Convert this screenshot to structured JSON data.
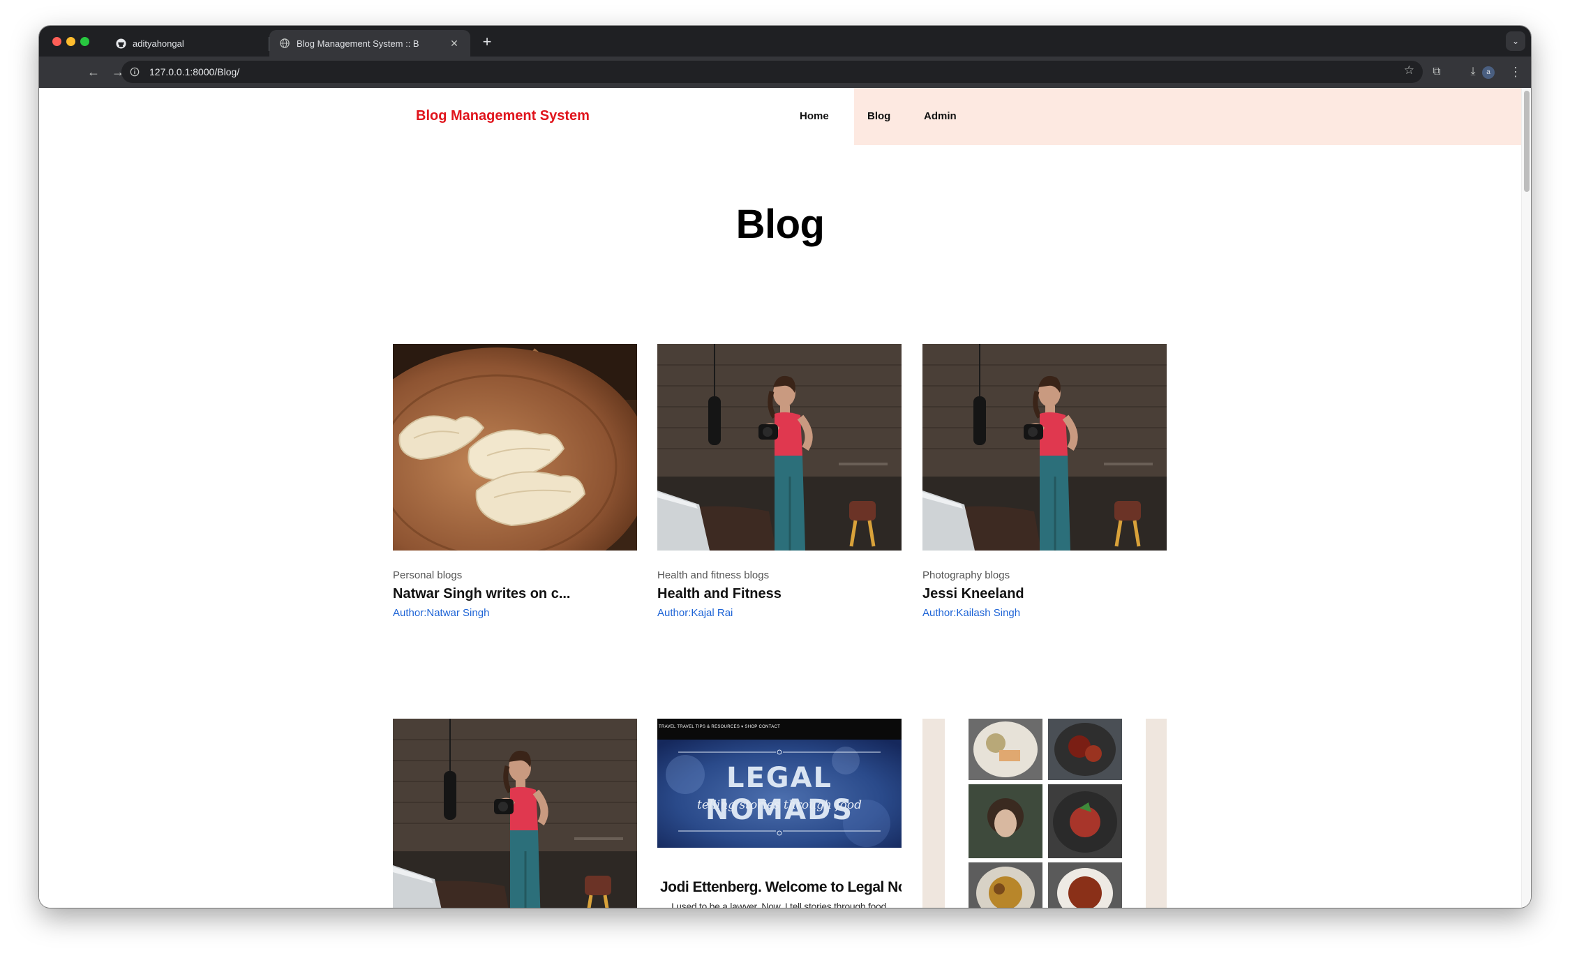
{
  "browser": {
    "tabs": [
      {
        "label": "adityahongal",
        "favicon": "github-icon"
      },
      {
        "label": "Blog Management System :: B",
        "favicon": "globe-icon"
      }
    ],
    "url": "127.0.0.1:8000/Blog/",
    "profile_initial": "a"
  },
  "nav": {
    "brand": "Blog Management System",
    "links": [
      "Home",
      "Blog",
      "Admin"
    ]
  },
  "page": {
    "heading": "Blog"
  },
  "cards": [
    {
      "category": "Personal blogs",
      "title": "Natwar Singh writes on c...",
      "author": "Author:Natwar Singh",
      "image": "dumplings-photo"
    },
    {
      "category": "Health and fitness blogs",
      "title": "Health and Fitness",
      "author": "Author:Kajal Rai",
      "image": "fitness-photographer-photo"
    },
    {
      "category": "Photography blogs",
      "title": "Jessi Kneeland",
      "author": "Author:Kailash Singh",
      "image": "fitness-photographer-photo"
    },
    {
      "image": "fitness-photographer-photo"
    },
    {
      "image": "legal-nomads-screenshot",
      "banner_nav": "TRAVEL   TRAVEL TIPS & RESOURCES ▾   SHOP   CONTACT",
      "banner_title": "LEGAL NOMADS",
      "banner_tagline": "telling stories through food",
      "welcome": "Jodi Ettenberg. Welcome to Legal No",
      "subline": "I used to be a lawyer. Now, I tell stories through food."
    },
    {
      "image": "food-grid-screenshot"
    }
  ],
  "colors": {
    "brand": "#e0141c",
    "nav_highlight": "#fde9e1",
    "author_link": "#1e64d6"
  }
}
